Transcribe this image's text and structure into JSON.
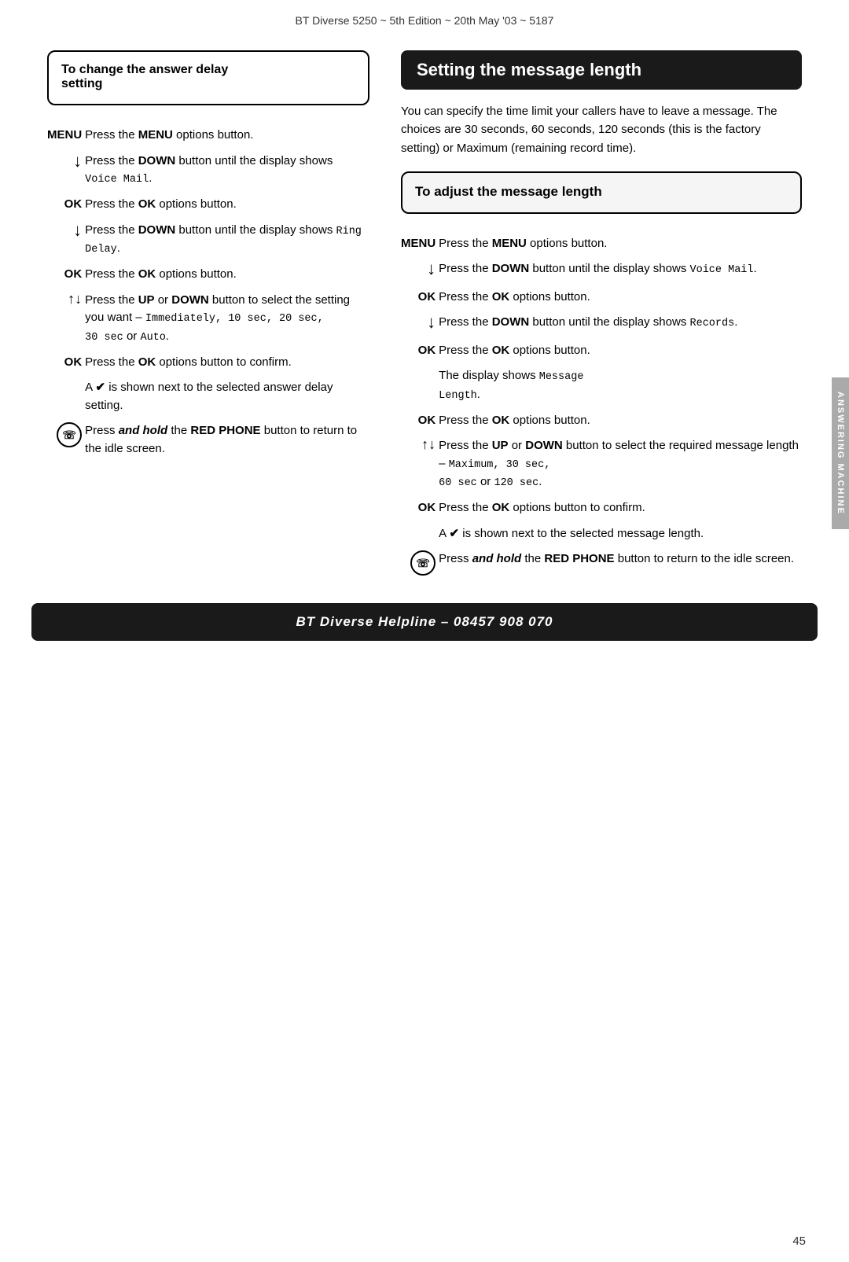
{
  "header": {
    "title": "BT Diverse 5250 ~ 5th Edition ~ 20th May '03 ~ 5187"
  },
  "left_column": {
    "box_title_line1": "To change the answer delay",
    "box_title_line2": "setting",
    "steps": [
      {
        "label": "MENU",
        "text": "Press the ",
        "bold": "MENU",
        "text2": " options button."
      },
      {
        "label": "↓",
        "text": "Press the ",
        "bold": "DOWN",
        "text2": " button until the display shows ",
        "mono": "Voice Mail",
        "text3": "."
      },
      {
        "label": "OK",
        "text": "Press the ",
        "bold": "OK",
        "text2": " options button."
      },
      {
        "label": "↓",
        "text": "Press the ",
        "bold": "DOWN",
        "text2": " button until the display shows ",
        "mono": "Ring Delay",
        "text3": "."
      },
      {
        "label": "OK",
        "text": "Press the ",
        "bold": "OK",
        "text2": " options button."
      },
      {
        "label": "↑↓",
        "text": "Press the ",
        "bold_up": "UP",
        "text_or": " or ",
        "bold_down": "DOWN",
        "text2": " button to select the setting you want – ",
        "mono": "Immediately, 10 sec, 20 sec, 30 sec",
        "text3": " or ",
        "mono2": "Auto",
        "text4": "."
      },
      {
        "label": "OK",
        "text": "Press the ",
        "bold": "OK",
        "text2": " options button to confirm."
      },
      {
        "label": "✔",
        "type": "note",
        "text": "A ✔ is shown next to the selected answer delay setting."
      },
      {
        "label": "📞",
        "type": "phone",
        "text": "Press ",
        "italic_bold": "and hold",
        "text2": " the ",
        "bold": "RED PHONE",
        "text3": " button to return to the idle screen."
      }
    ]
  },
  "right_column": {
    "section_title": "Setting the message length",
    "intro": "You can specify the time limit your callers have to leave a message. The choices are 30 seconds, 60 seconds, 120 seconds (this is the factory setting) or Maximum (remaining record time).",
    "box_title": "To adjust the message length",
    "steps": [
      {
        "label": "MENU",
        "text": "Press the ",
        "bold": "MENU",
        "text2": " options button."
      },
      {
        "label": "↓",
        "text": "Press the ",
        "bold": "DOWN",
        "text2": " button until the display shows ",
        "mono": "Voice Mail",
        "text3": "."
      },
      {
        "label": "OK",
        "text": "Press the ",
        "bold": "OK",
        "text2": " options button."
      },
      {
        "label": "↓",
        "text": "Press the ",
        "bold": "DOWN",
        "text2": " button until the display shows ",
        "mono": "Records",
        "text3": "."
      },
      {
        "label": "OK",
        "text": "Press the ",
        "bold": "OK",
        "text2": " options button."
      },
      {
        "label": "display",
        "type": "note",
        "text": "The display shows ",
        "mono": "Message Length",
        "text2": "."
      },
      {
        "label": "OK",
        "text": "Press the ",
        "bold": "OK",
        "text2": " options button."
      },
      {
        "label": "↑↓",
        "text": "Press the ",
        "bold_up": "UP",
        "text_or": " or ",
        "bold_down": "DOWN",
        "text2": " button to select the required message length – ",
        "mono": "Maximum, 30 sec, 60 sec",
        "text3": " or ",
        "mono2": "120 sec",
        "text4": "."
      },
      {
        "label": "OK",
        "text": "Press the ",
        "bold": "OK",
        "text2": " options button to confirm."
      },
      {
        "label": "✔",
        "type": "note",
        "text": "A ✔ is shown next to the selected message length."
      },
      {
        "label": "📞",
        "type": "phone",
        "text": "Press ",
        "italic_bold": "and hold",
        "text2": " the ",
        "bold": "RED PHONE",
        "text3": " button to return to the idle screen."
      }
    ]
  },
  "side_tab": {
    "label": "ANSWERING MACHINE"
  },
  "footer": {
    "text": "BT Diverse Helpline – 08457 908 070"
  },
  "page_number": "45"
}
